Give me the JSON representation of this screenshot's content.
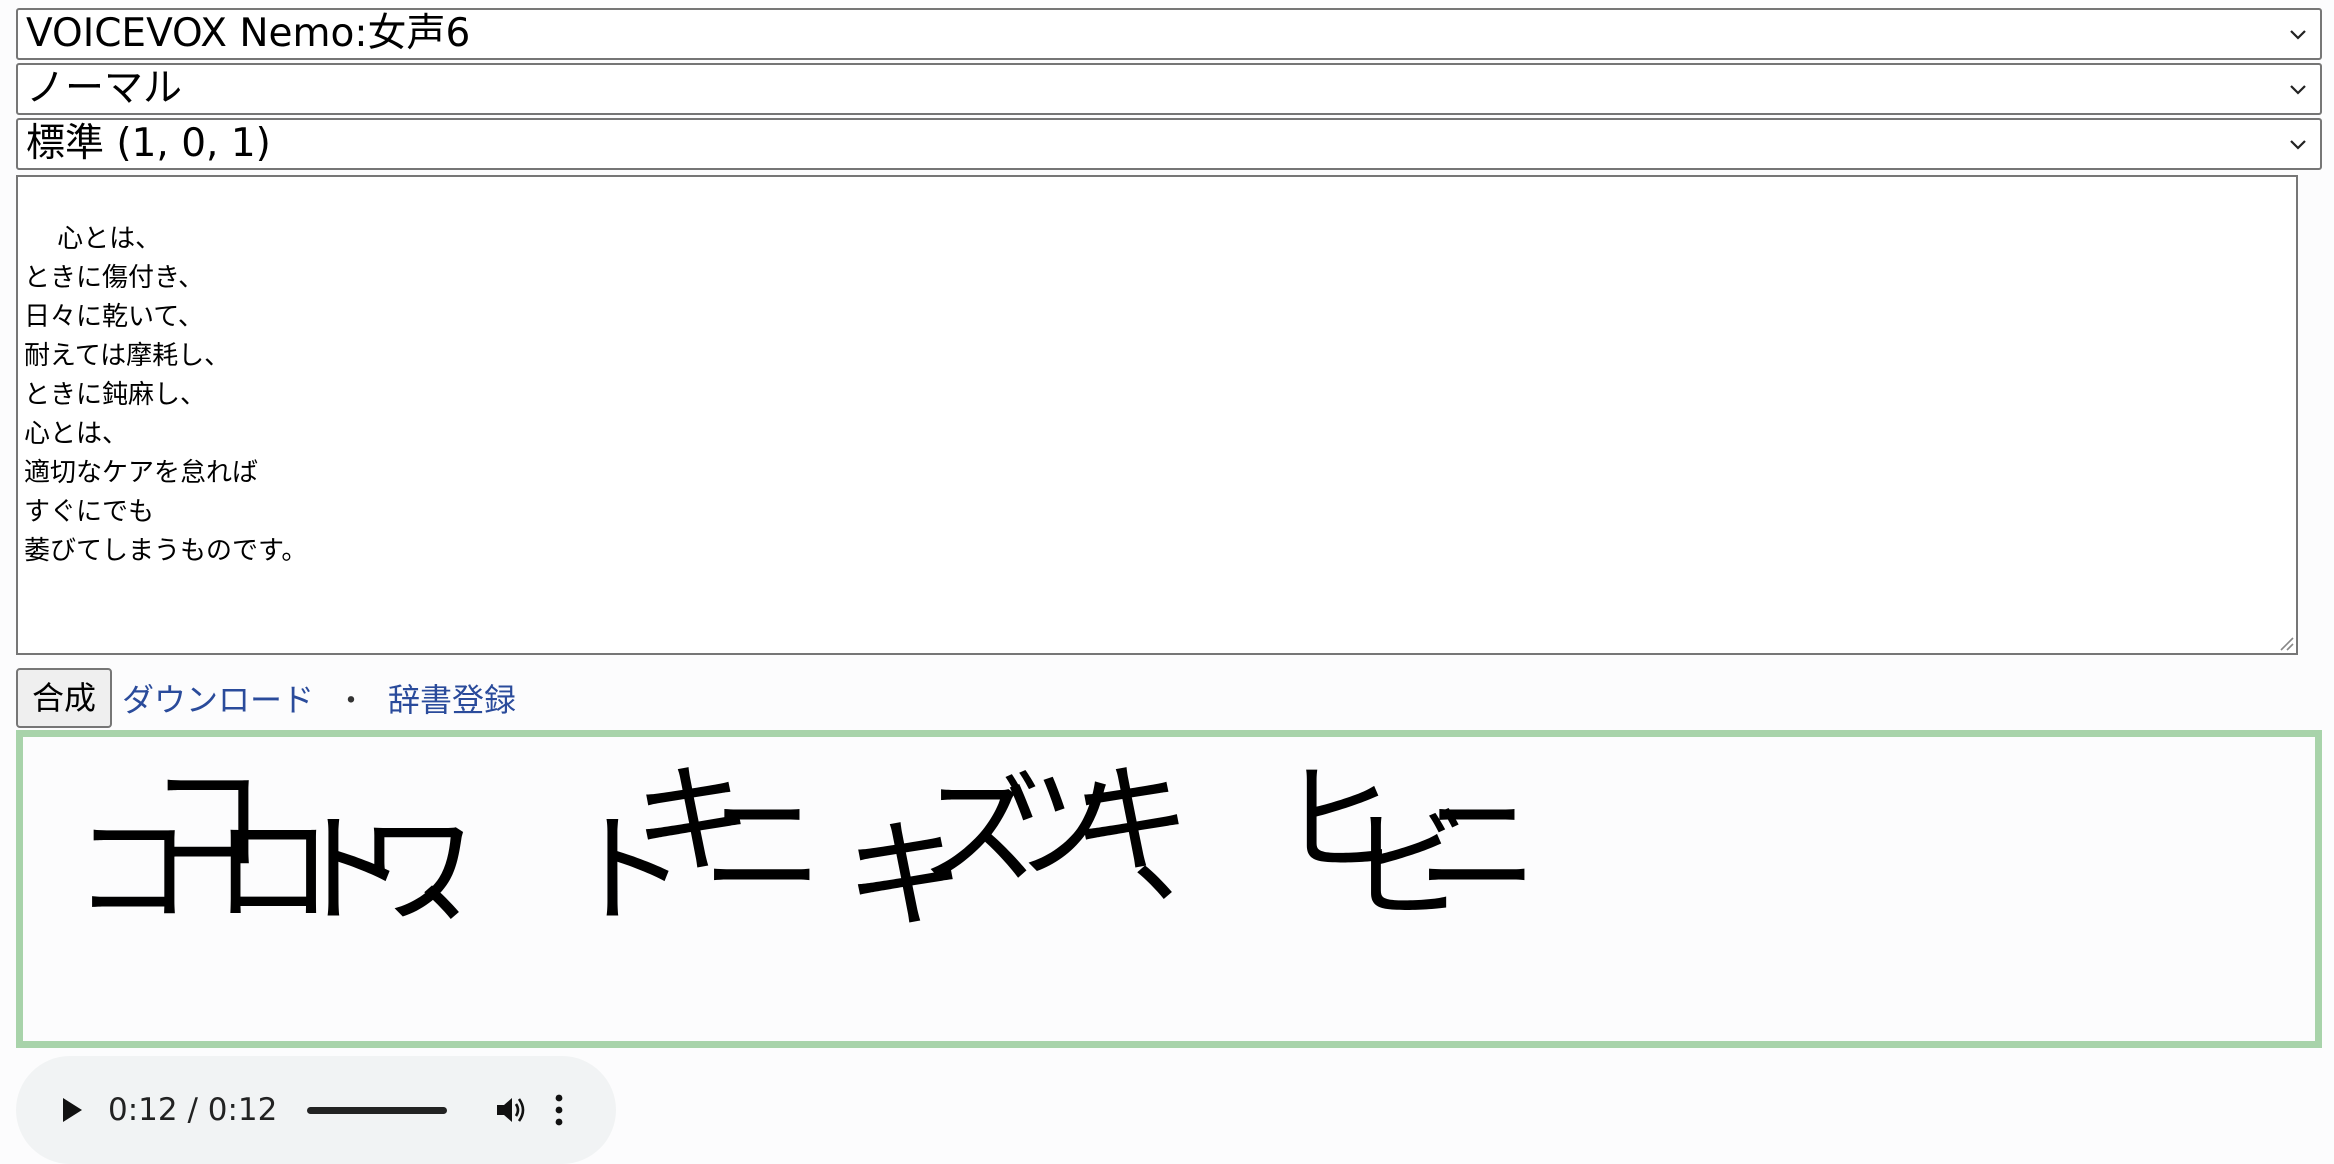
{
  "speaker_select": {
    "value": "VOICEVOX Nemo:女声6"
  },
  "style_select": {
    "value": "ノーマル"
  },
  "preset_select": {
    "value": "標準 (1, 0, 1)"
  },
  "text_input": {
    "value": "心とは、\nときに傷付き、\n日々に乾いて、\n耐えては摩耗し、\nときに鈍麻し、\n心とは、\n適切なケアを怠れば\nすぐにでも\n萎びてしまうものです。"
  },
  "controls": {
    "synth_label": "合成",
    "download_label": "ダウンロード",
    "separator": "・",
    "dictionary_label": "辞書登録"
  },
  "accent": {
    "border_color": "#a8d3aa",
    "morae": [
      "コ",
      "コ",
      "ロ",
      "ト",
      "ワ",
      "、",
      "ト",
      "キ",
      "ニ",
      "キ",
      "ズ",
      "ツ",
      "キ",
      "、",
      "ヒ",
      "ビ",
      "ニ"
    ]
  },
  "audio": {
    "time": "0:12 / 0:12",
    "progress": 1.0,
    "play_icon": "play-icon",
    "volume_icon": "volume-icon",
    "more_icon": "more-vert-icon"
  }
}
